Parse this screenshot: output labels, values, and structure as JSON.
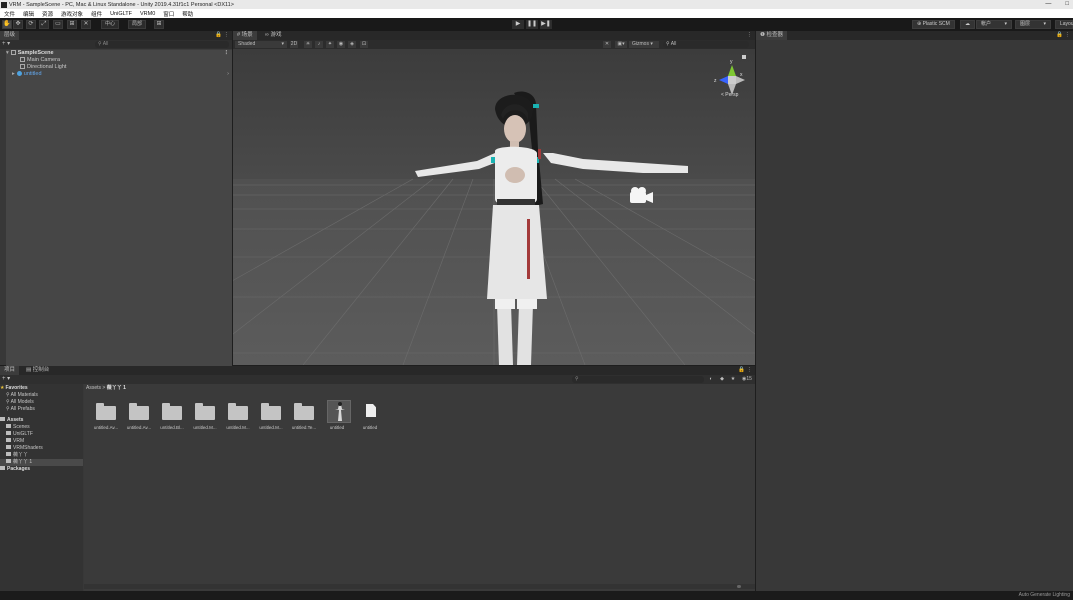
{
  "window": {
    "title": "VRM - SampleScene - PC, Mac & Linux Standalone - Unity 2019.4.31f1c1 Personal <DX11>",
    "buttons": [
      "—",
      "□"
    ]
  },
  "menu": [
    "文件",
    "编辑",
    "资源",
    "游戏对象",
    "组件",
    "UniGLTF",
    "VRM0",
    "窗口",
    "帮助"
  ],
  "toolbar": {
    "tools": [
      "✋",
      "✥",
      "⟳",
      "⤢",
      "▭",
      "⊞",
      "✕"
    ],
    "pivot_label": "中心",
    "local_label": "局部",
    "grid_icon": "grid-snap-icon",
    "play_controls": [
      "▶",
      "❚❚",
      "▶❚"
    ],
    "plastic_scm": "⊕ Plastic SCM",
    "cloud_icon": "☁",
    "account": "帐户",
    "layers": "图层",
    "layout": "Layout"
  },
  "hierarchy": {
    "tab_label": "层级",
    "search_placeholder": "All",
    "items": [
      {
        "label": "SampleScene",
        "type": "scene",
        "menu": "⋮"
      },
      {
        "label": "Main Camera"
      },
      {
        "label": "Directional Light"
      },
      {
        "label": "untitled",
        "highlight": true,
        "more": "›"
      }
    ]
  },
  "scene": {
    "tabs": [
      "# 场景",
      "∞ 游戏"
    ],
    "shading": "Shaded",
    "mode_2d": "2D",
    "gizmos": "Gizmos",
    "search_placeholder": "All",
    "persp_label": "< Persp",
    "axis_labels": {
      "x": "x",
      "y": "y",
      "z": "z"
    },
    "colors": {
      "sky": "#3e3e3e",
      "ground": "#5a5a5a",
      "grid": "#6e6e6e"
    }
  },
  "inspector": {
    "tab_label": "检查器"
  },
  "project": {
    "tabs": [
      "项目",
      "控制台"
    ],
    "search_placeholder": "",
    "badge_count": "15",
    "sidebar": [
      {
        "label": "Favorites",
        "kind": "head-star"
      },
      {
        "label": "All Materials",
        "kind": "search"
      },
      {
        "label": "All Models",
        "kind": "search"
      },
      {
        "label": "All Prefabs",
        "kind": "search"
      },
      {
        "label": "Assets",
        "kind": "head-folder"
      },
      {
        "label": "Scenes",
        "kind": "folder"
      },
      {
        "label": "UniGLTF",
        "kind": "folder"
      },
      {
        "label": "VRM",
        "kind": "folder"
      },
      {
        "label": "VRMShaders",
        "kind": "folder"
      },
      {
        "label": "薇丫丫",
        "kind": "folder"
      },
      {
        "label": "薇丫丫 1",
        "kind": "folder",
        "selected": true
      },
      {
        "label": "Packages",
        "kind": "head-folder"
      }
    ],
    "breadcrumb": {
      "root": "Assets",
      "sep": ">",
      "current": "薇丫丫 1"
    },
    "assets": [
      {
        "name": "untitled.Av...",
        "kind": "folder"
      },
      {
        "name": "untitled.Av...",
        "kind": "folder"
      },
      {
        "name": "untitled.Bl...",
        "kind": "folder"
      },
      {
        "name": "untitled.M...",
        "kind": "folder"
      },
      {
        "name": "untitled.M...",
        "kind": "folder"
      },
      {
        "name": "untitled.M...",
        "kind": "folder"
      },
      {
        "name": "untitled.Te...",
        "kind": "folder"
      },
      {
        "name": "untitled",
        "kind": "prefab"
      },
      {
        "name": "untitled",
        "kind": "file"
      }
    ]
  },
  "status": {
    "text": "Auto Generate Lighting"
  }
}
